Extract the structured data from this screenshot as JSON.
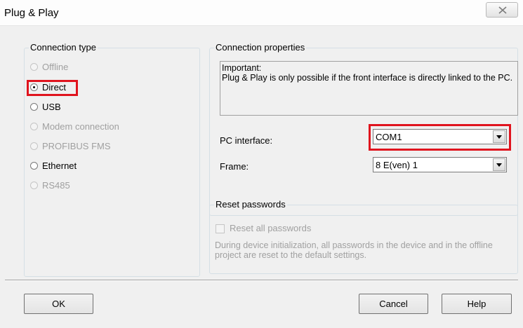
{
  "window": {
    "title": "Plug & Play"
  },
  "connection_type": {
    "legend": "Connection type",
    "options": [
      {
        "label": "Offline",
        "enabled": false,
        "selected": false
      },
      {
        "label": "Direct",
        "enabled": true,
        "selected": true
      },
      {
        "label": "USB",
        "enabled": true,
        "selected": false
      },
      {
        "label": "Modem connection",
        "enabled": false,
        "selected": false
      },
      {
        "label": "PROFIBUS FMS",
        "enabled": false,
        "selected": false
      },
      {
        "label": "Ethernet",
        "enabled": true,
        "selected": false
      },
      {
        "label": "RS485",
        "enabled": false,
        "selected": false
      }
    ]
  },
  "connection_properties": {
    "legend": "Connection properties",
    "info_heading": "Important:",
    "info_text": "Plug & Play is only possible if the front interface is directly linked to the PC.",
    "pc_interface": {
      "label": "PC interface:",
      "value": "COM1"
    },
    "frame": {
      "label": "Frame:",
      "value": "8 E(ven) 1"
    }
  },
  "reset_passwords": {
    "legend": "Reset passwords",
    "checkbox_label": "Reset all passwords",
    "checked": false,
    "description": "During device initialization, all passwords in the device and in the offline project are reset to the default settings."
  },
  "buttons": {
    "ok": "OK",
    "cancel": "Cancel",
    "help": "Help"
  },
  "colors": {
    "highlight": "#e0141e",
    "dialog_bg": "#f0f0f0",
    "disabled_text": "#a0a0a0"
  }
}
